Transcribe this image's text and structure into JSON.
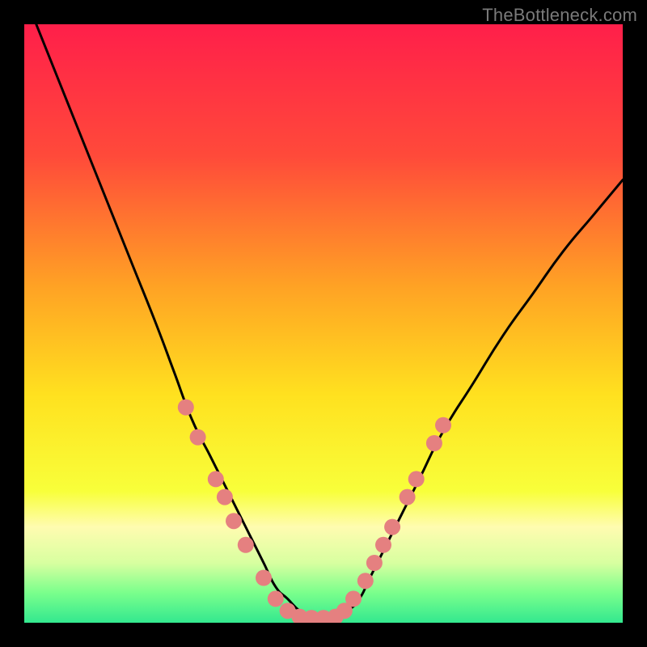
{
  "watermark": "TheBottleneck.com",
  "chart_data": {
    "type": "line",
    "title": "",
    "xlabel": "",
    "ylabel": "",
    "xlim": [
      0,
      100
    ],
    "ylim": [
      0,
      100
    ],
    "gradient_stops": [
      {
        "pct": 0,
        "color": "#ff1f4a"
      },
      {
        "pct": 22,
        "color": "#ff4a3a"
      },
      {
        "pct": 44,
        "color": "#ffa324"
      },
      {
        "pct": 62,
        "color": "#ffe11f"
      },
      {
        "pct": 78,
        "color": "#f8ff3a"
      },
      {
        "pct": 84,
        "color": "#fffcb0"
      },
      {
        "pct": 90,
        "color": "#d8ffa0"
      },
      {
        "pct": 95,
        "color": "#7aff8c"
      },
      {
        "pct": 100,
        "color": "#33e88f"
      }
    ],
    "series": [
      {
        "name": "bottleneck-curve",
        "x": [
          2,
          6,
          10,
          14,
          18,
          22,
          25,
          28,
          31,
          33,
          36,
          38,
          40,
          42,
          44,
          46,
          48,
          52,
          54,
          56,
          58,
          62,
          66,
          70,
          75,
          80,
          85,
          90,
          95,
          100
        ],
        "y": [
          100,
          90,
          80,
          70,
          60,
          50,
          42,
          34,
          28,
          24,
          18,
          14,
          10,
          6,
          4,
          2,
          1,
          1,
          2,
          4,
          8,
          16,
          24,
          32,
          40,
          48,
          55,
          62,
          68,
          74
        ]
      }
    ],
    "markers": {
      "name": "highlight-dots",
      "color": "#e58080",
      "radius": 10,
      "points": [
        {
          "x": 27,
          "y": 36
        },
        {
          "x": 29,
          "y": 31
        },
        {
          "x": 32,
          "y": 24
        },
        {
          "x": 33.5,
          "y": 21
        },
        {
          "x": 35,
          "y": 17
        },
        {
          "x": 37,
          "y": 13
        },
        {
          "x": 40,
          "y": 7.5
        },
        {
          "x": 42,
          "y": 4
        },
        {
          "x": 44,
          "y": 2
        },
        {
          "x": 46,
          "y": 1
        },
        {
          "x": 48,
          "y": 0.8
        },
        {
          "x": 50,
          "y": 0.8
        },
        {
          "x": 52,
          "y": 1
        },
        {
          "x": 53.5,
          "y": 2
        },
        {
          "x": 55,
          "y": 4
        },
        {
          "x": 57,
          "y": 7
        },
        {
          "x": 58.5,
          "y": 10
        },
        {
          "x": 60,
          "y": 13
        },
        {
          "x": 61.5,
          "y": 16
        },
        {
          "x": 64,
          "y": 21
        },
        {
          "x": 65.5,
          "y": 24
        },
        {
          "x": 68.5,
          "y": 30
        },
        {
          "x": 70,
          "y": 33
        }
      ]
    }
  }
}
